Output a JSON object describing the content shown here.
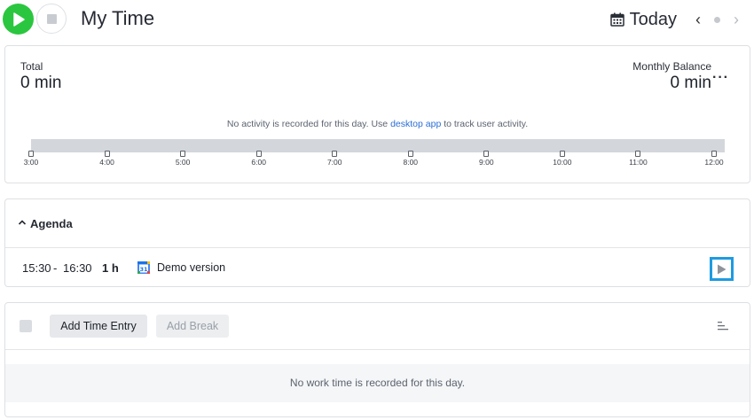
{
  "header": {
    "title": "My Time",
    "date_label": "Today",
    "prev_icon": "chevron-left-icon",
    "next_icon": "chevron-right-icon",
    "calendar_icon": "calendar-icon"
  },
  "colors": {
    "play_green": "#2bc63f",
    "link_blue": "#2a6fd6",
    "focus_blue": "#1e9be0",
    "timeline_grey": "#d3d6db"
  },
  "summary": {
    "total_label": "Total",
    "total_value": "0 min",
    "balance_label": "Monthly Balance",
    "balance_value": "0 min",
    "more_label": "···",
    "activity_msg_before": "No activity is recorded for this day. Use ",
    "activity_link": "desktop app",
    "activity_msg_after": " to track user activity.",
    "timeline_ticks": [
      "3:00",
      "4:00",
      "5:00",
      "6:00",
      "7:00",
      "8:00",
      "9:00",
      "10:00",
      "11:00",
      "12:00"
    ]
  },
  "agenda": {
    "title": "Agenda",
    "items": [
      {
        "start": "15:30",
        "dash": "-",
        "end": "16:30",
        "duration": "1 h",
        "title": "Demo version",
        "icon": "google-calendar-icon"
      }
    ]
  },
  "entries": {
    "add_entry_label": "Add Time Entry",
    "add_break_label": "Add Break",
    "empty_message": "No work time is recorded for this day."
  }
}
